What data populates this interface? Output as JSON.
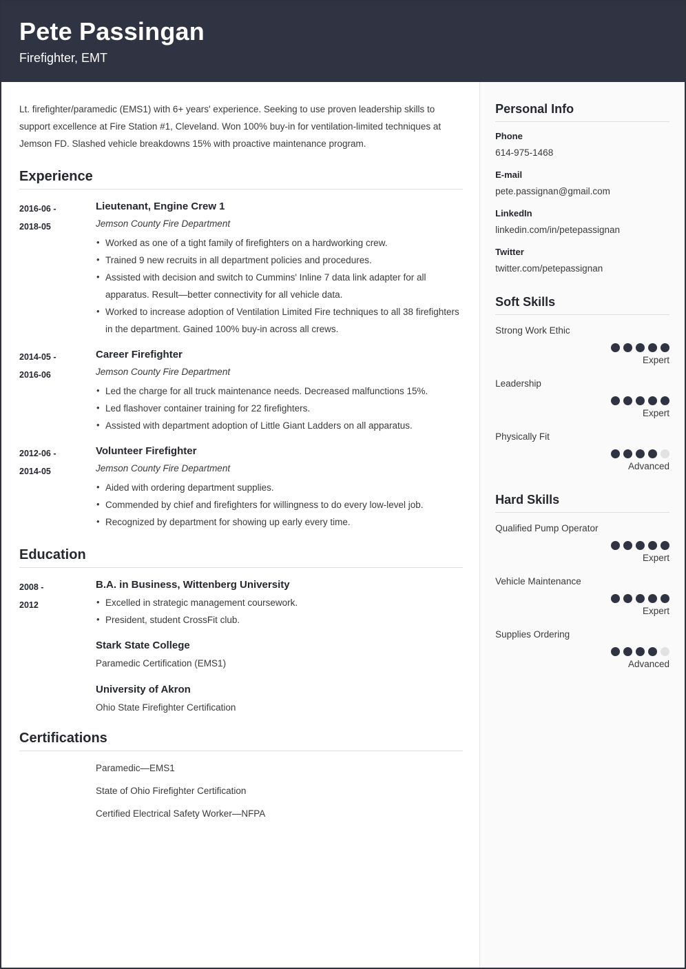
{
  "header": {
    "name": "Pete Passingan",
    "title": "Firefighter, EMT",
    "bg_color": "#2f3342"
  },
  "summary": "Lt. firefighter/paramedic (EMS1) with 6+ years' experience. Seeking to use proven leadership skills to support excellence at Fire Station #1, Cleveland. Won 100% buy-in for ventilation-limited techniques at Jemson FD. Slashed vehicle breakdowns 15% with proactive maintenance program.",
  "sections": {
    "experience": {
      "heading": "Experience",
      "entries": [
        {
          "date": "2016-06 - 2018-05",
          "date_line1": "2016-06 -",
          "date_line2": "2018-05",
          "title": "Lieutenant, Engine Crew 1",
          "org": "Jemson County Fire Department",
          "bullets": [
            "Worked as one of a tight family of firefighters on a hardworking crew.",
            "Trained 9 new recruits in all department policies and procedures.",
            "Assisted with decision and switch to Cummins' Inline 7 data link adapter for all apparatus. Result—better connectivity for all vehicle data.",
            "Worked to increase adoption of Ventilation Limited Fire techniques to all 38 firefighters in the department. Gained 100% buy-in across all crews."
          ]
        },
        {
          "date": "2014-05 - 2016-06",
          "date_line1": "2014-05 -",
          "date_line2": "2016-06",
          "title": "Career Firefighter",
          "org": "Jemson County Fire Department",
          "bullets": [
            "Led the charge for all truck maintenance needs. Decreased malfunctions 15%.",
            "Led flashover container training for 22 firefighters.",
            "Assisted with department adoption of Little Giant Ladders on all apparatus."
          ]
        },
        {
          "date": "2012-06 - 2014-05",
          "date_line1": "2012-06 -",
          "date_line2": "2014-05",
          "title": "Volunteer Firefighter",
          "org": "Jemson County Fire Department",
          "bullets": [
            "Aided with ordering department supplies.",
            "Commended by chief and firefighters for willingness to do every low-level job.",
            "Recognized by department for showing up early every time."
          ]
        }
      ]
    },
    "education": {
      "heading": "Education",
      "date_line1": "2008 -",
      "date_line2": "2012",
      "primary": {
        "title": "B.A. in Business, Wittenberg University",
        "bullets": [
          "Excelled in strategic management coursework.",
          "President, student CrossFit club."
        ]
      },
      "others": [
        {
          "title": "Stark State College",
          "detail": "Paramedic Certification (EMS1)"
        },
        {
          "title": "University of Akron",
          "detail": "Ohio State Firefighter Certification"
        }
      ]
    },
    "certifications": {
      "heading": "Certifications",
      "items": [
        "Paramedic—EMS1",
        "State of Ohio Firefighter Certification",
        "Certified Electrical Safety Worker—NFPA"
      ]
    }
  },
  "sidebar": {
    "personal_info": {
      "heading": "Personal Info",
      "items": [
        {
          "label": "Phone",
          "value": "614-975-1468"
        },
        {
          "label": "E-mail",
          "value": "pete.passignan@gmail.com"
        },
        {
          "label": "LinkedIn",
          "value": "linkedin.com/in/petepassignan"
        },
        {
          "label": "Twitter",
          "value": "twitter.com/petepassignan"
        }
      ]
    },
    "soft_skills": {
      "heading": "Soft Skills",
      "items": [
        {
          "name": "Strong Work Ethic",
          "rating": 5,
          "max": 5,
          "level": "Expert"
        },
        {
          "name": "Leadership",
          "rating": 5,
          "max": 5,
          "level": "Expert"
        },
        {
          "name": "Physically Fit",
          "rating": 4,
          "max": 5,
          "level": "Advanced"
        }
      ]
    },
    "hard_skills": {
      "heading": "Hard Skills",
      "items": [
        {
          "name": "Qualified Pump Operator",
          "rating": 5,
          "max": 5,
          "level": "Expert"
        },
        {
          "name": "Vehicle Maintenance",
          "rating": 5,
          "max": 5,
          "level": "Expert"
        },
        {
          "name": "Supplies Ordering",
          "rating": 4,
          "max": 5,
          "level": "Advanced"
        }
      ]
    },
    "dot_colors": {
      "filled": "#2f3342",
      "empty": "#e2e2e2"
    }
  }
}
